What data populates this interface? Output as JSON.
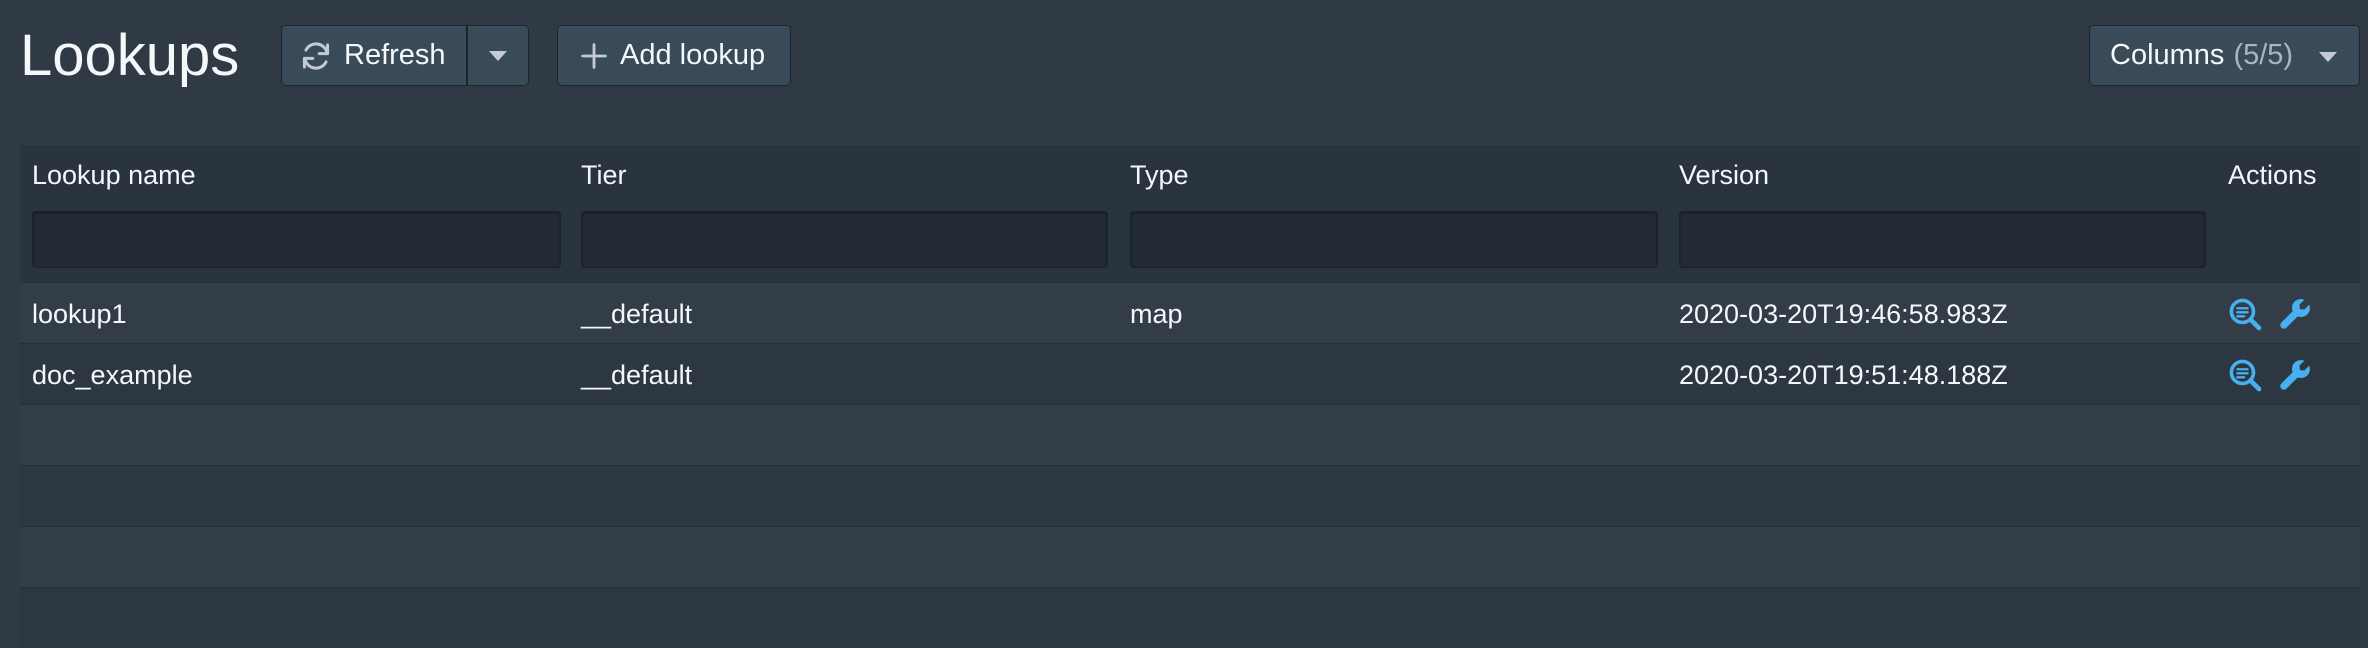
{
  "header": {
    "title": "Lookups",
    "refresh_label": "Refresh",
    "add_label": "Add lookup",
    "columns_label": "Columns",
    "columns_count": "(5/5)"
  },
  "table": {
    "columns": [
      "Lookup name",
      "Tier",
      "Type",
      "Version",
      "Actions"
    ],
    "filters": [
      "",
      "",
      "",
      ""
    ],
    "rows": [
      {
        "name": "lookup1",
        "tier": "__default",
        "type": "map",
        "version": "2020-03-20T19:46:58.983Z"
      },
      {
        "name": "doc_example",
        "tier": "__default",
        "type": "",
        "version": "2020-03-20T19:51:48.188Z"
      }
    ]
  },
  "icons": {
    "refresh": "refresh-icon",
    "add": "plus-icon",
    "caret": "caret-down-icon",
    "view": "search-text-icon",
    "edit": "wrench-icon"
  },
  "colors": {
    "background": "#2f3a45",
    "accent_icon": "#48aff0",
    "button": "#394b59"
  }
}
